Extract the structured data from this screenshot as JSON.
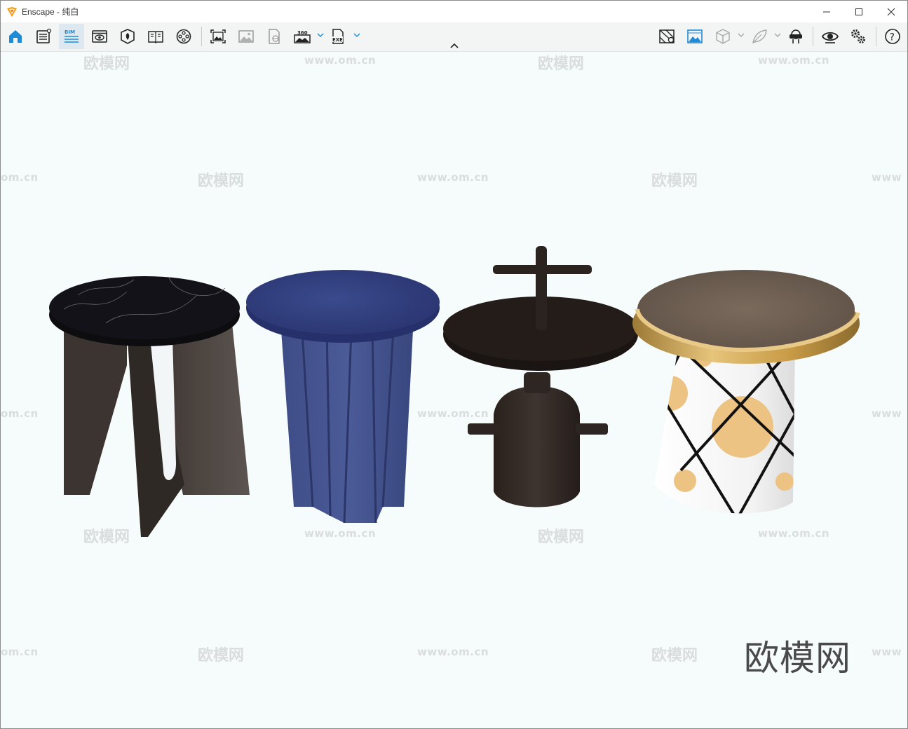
{
  "window": {
    "title": "Enscape - 纯白",
    "controls": {
      "minimize": "—",
      "maximize": "☐",
      "close": "✕"
    }
  },
  "toolbar": {
    "left_icons": [
      "home-icon",
      "sketch-list-icon",
      "bim-icon",
      "visual-settings-icon",
      "asset-library-icon",
      "material-book-icon",
      "video-editor-icon",
      "screenshot-icon",
      "batch-render-icon",
      "web-standalone-icon",
      "panorama-360-icon",
      "exe-export-icon"
    ],
    "right_icons": [
      "orthographic-icon",
      "image-rendering-icon",
      "cube-view-icon",
      "leaf-icon",
      "vr-headset-icon",
      "eye-icon",
      "settings-icon",
      "help-icon"
    ],
    "bim_label": "BIM",
    "panorama_label": "360",
    "exe_label": "EXE",
    "help_label": "?",
    "accent_color": "#1f8bd6"
  },
  "viewport": {
    "watermark_url": "www.om.cn",
    "watermark_partial_left": "om.cn",
    "watermark_partial_right": "www",
    "watermark_cn": "欧模网",
    "watermark_logo": "欧模网"
  }
}
